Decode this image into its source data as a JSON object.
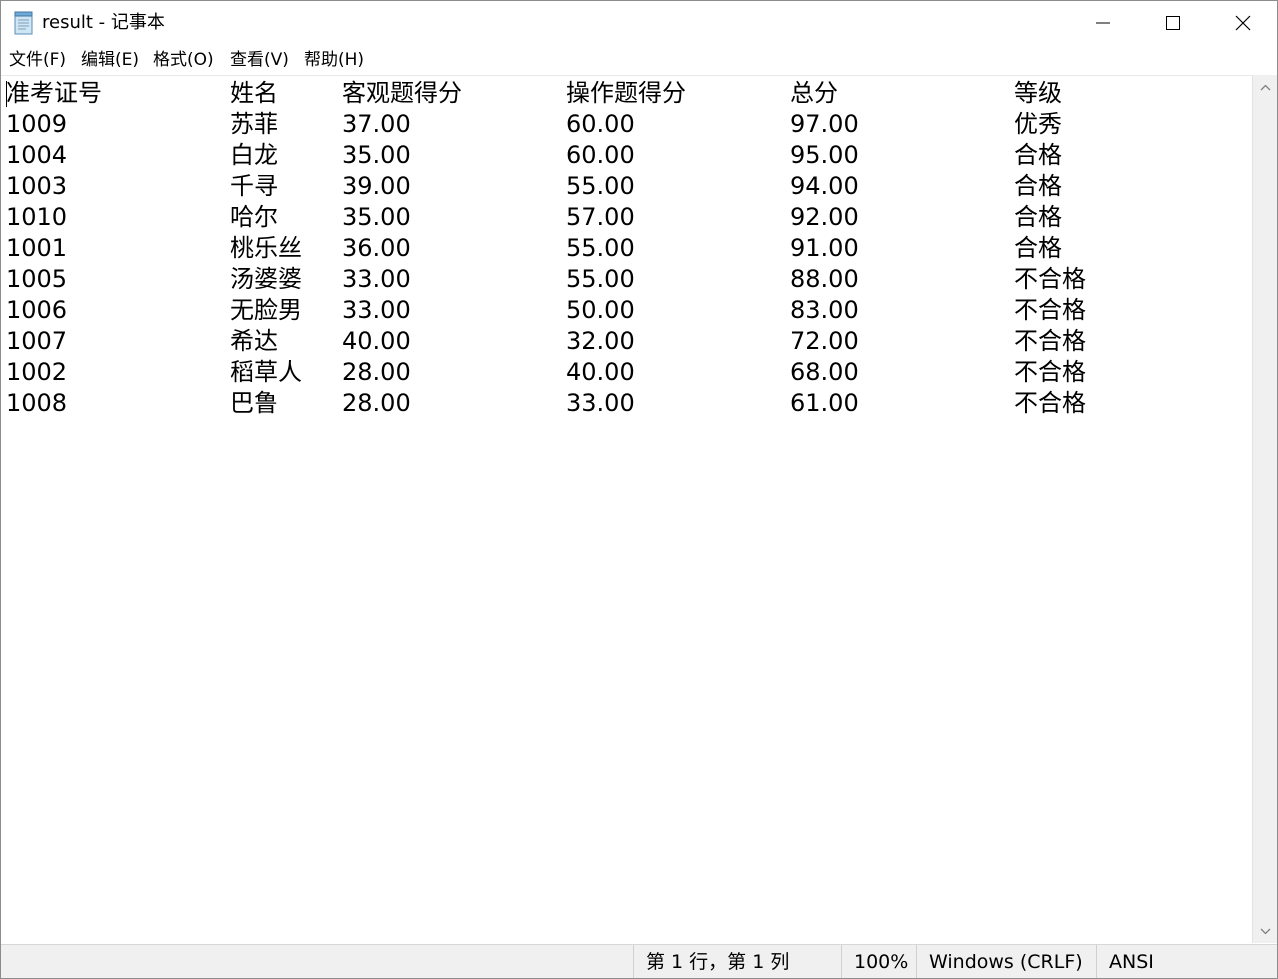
{
  "window": {
    "title": "result - 记事本",
    "icon": "notepad-icon"
  },
  "menu": [
    {
      "label": "文件(F)"
    },
    {
      "label": "编辑(E)"
    },
    {
      "label": "格式(O)"
    },
    {
      "label": "查看(V)"
    },
    {
      "label": "帮助(H)"
    }
  ],
  "table": {
    "headers": [
      "准考证号",
      "姓名",
      "客观题得分",
      "操作题得分",
      "总分",
      "等级"
    ],
    "rows": [
      [
        "1009",
        "苏菲",
        "37.00",
        "60.00",
        "97.00",
        "优秀"
      ],
      [
        "1004",
        "白龙",
        "35.00",
        "60.00",
        "95.00",
        "合格"
      ],
      [
        "1003",
        "千寻",
        "39.00",
        "55.00",
        "94.00",
        "合格"
      ],
      [
        "1010",
        "哈尔",
        "35.00",
        "57.00",
        "92.00",
        "合格"
      ],
      [
        "1001",
        "桃乐丝",
        "36.00",
        "55.00",
        "91.00",
        "合格"
      ],
      [
        "1005",
        "汤婆婆",
        "33.00",
        "55.00",
        "88.00",
        "不合格"
      ],
      [
        "1006",
        "无脸男",
        "33.00",
        "50.00",
        "83.00",
        "不合格"
      ],
      [
        "1007",
        "希达",
        "40.00",
        "32.00",
        "72.00",
        "不合格"
      ],
      [
        "1002",
        "稻草人",
        "28.00",
        "40.00",
        "68.00",
        "不合格"
      ],
      [
        "1008",
        "巴鲁",
        "28.00",
        "33.00",
        "61.00",
        "不合格"
      ]
    ]
  },
  "status": {
    "position": "第 1 行，第 1 列",
    "zoom": "100%",
    "line_ending": "Windows (CRLF)",
    "encoding": "ANSI"
  },
  "icons": {
    "minimize": "minimize-icon",
    "maximize": "maximize-icon",
    "close": "close-icon",
    "scroll_up": "scroll-up-arrow-icon",
    "scroll_down": "scroll-down-arrow-icon"
  }
}
